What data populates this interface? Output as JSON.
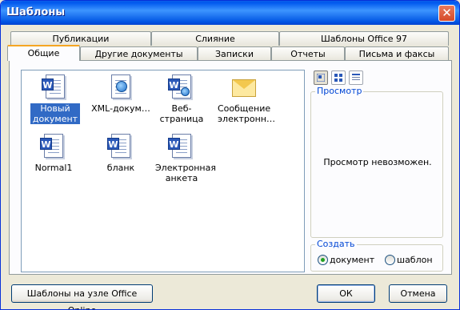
{
  "window": {
    "title": "Шаблоны",
    "close_glyph": "✕"
  },
  "tabs_row1": [
    "Публикации",
    "Слияние",
    "Шаблоны Office 97"
  ],
  "tabs_row2": [
    "Общие",
    "Другие документы",
    "Записки",
    "Отчеты",
    "Письма и факсы"
  ],
  "active_tab": "Общие",
  "templates": [
    {
      "label": "Новый документ",
      "icon": "word-document-icon",
      "selected": true
    },
    {
      "label": "XML-докум…",
      "icon": "xml-document-icon",
      "selected": false
    },
    {
      "label": "Веб-страница",
      "icon": "web-page-icon",
      "selected": false
    },
    {
      "label": "Сообщение электронн…",
      "icon": "email-message-icon",
      "selected": false
    },
    {
      "label": "Normal1",
      "icon": "word-document-icon",
      "selected": false
    },
    {
      "label": "бланк",
      "icon": "word-document-icon",
      "selected": false
    },
    {
      "label": "Электронная анкета",
      "icon": "word-document-icon",
      "selected": false
    }
  ],
  "view_buttons": [
    "large-icons-view-icon",
    "list-view-icon",
    "details-view-icon"
  ],
  "preview": {
    "title": "Просмотр",
    "message": "Просмотр невозможен."
  },
  "create": {
    "title": "Создать",
    "options": [
      {
        "label": "документ",
        "checked": true
      },
      {
        "label": "шаблон",
        "checked": false
      }
    ]
  },
  "buttons": {
    "online": "Шаблоны на узле Office Online",
    "ok": "ОК",
    "cancel": "Отмена"
  },
  "colors": {
    "title_bar": "#0058ee",
    "selection": "#316ac5",
    "active_tab_accent": "#f5a623"
  }
}
